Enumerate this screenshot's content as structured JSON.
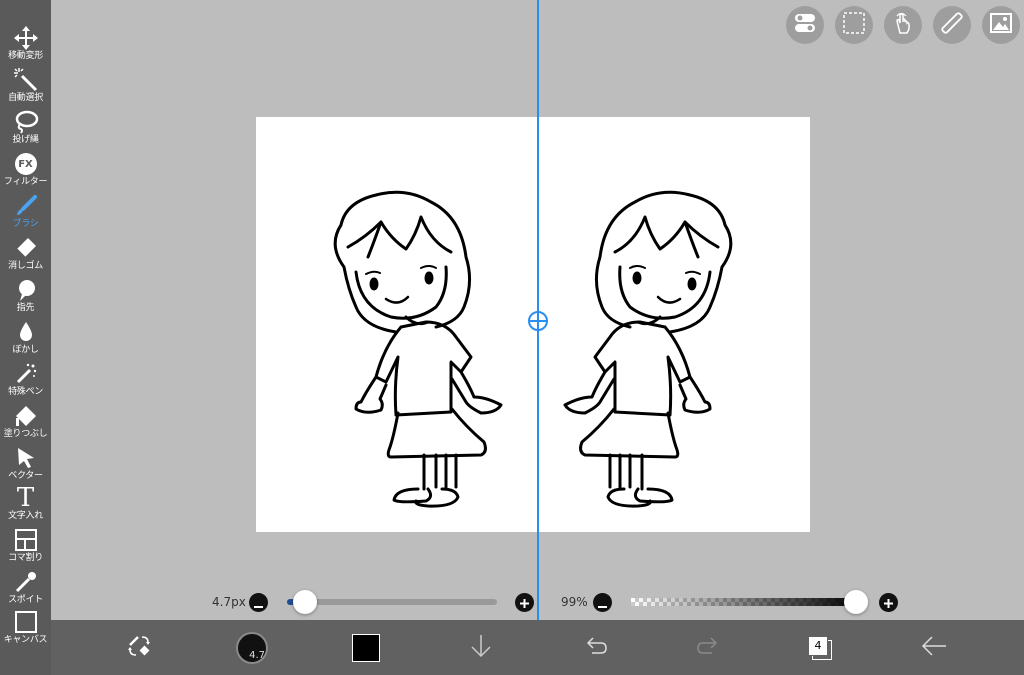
{
  "toolbar": {
    "items": [
      {
        "label": "移動変形",
        "icon": "move-icon"
      },
      {
        "label": "自動選択",
        "icon": "magic-wand-icon"
      },
      {
        "label": "投げ縄",
        "icon": "lasso-icon"
      },
      {
        "label": "フィルター",
        "icon": "fx-icon"
      },
      {
        "label": "ブラシ",
        "icon": "brush-icon"
      },
      {
        "label": "消しゴム",
        "icon": "eraser-icon"
      },
      {
        "label": "指先",
        "icon": "finger-icon"
      },
      {
        "label": "ぼかし",
        "icon": "blur-drop-icon"
      },
      {
        "label": "特殊ペン",
        "icon": "special-pen-icon"
      },
      {
        "label": "塗りつぶし",
        "icon": "bucket-icon"
      },
      {
        "label": "ベクター",
        "icon": "vector-arrow-icon"
      },
      {
        "label": "文字入れ",
        "icon": "text-icon"
      },
      {
        "label": "コマ割り",
        "icon": "panel-icon"
      },
      {
        "label": "スポイト",
        "icon": "eyedropper-icon"
      },
      {
        "label": "キャンバス",
        "icon": "canvas-icon"
      }
    ],
    "fx_glyph": "FX",
    "text_glyph": "T",
    "active_index": 4,
    "active_color": "#4aa3f0"
  },
  "top_buttons": [
    "toggle-icon",
    "selection-icon",
    "hand-gesture-icon",
    "ruler-icon",
    "image-icon"
  ],
  "brush_size": {
    "label": "4.7px",
    "value": 4.7,
    "slider_fraction": 0.08
  },
  "opacity": {
    "label": "99%",
    "value": 99
  },
  "bottom_bar": {
    "brush_preview_text": "4.7",
    "color": "#000000",
    "layer_count": "4"
  },
  "colors": {
    "symmetry_line": "#2a8ef0",
    "toolbar_bg": "#5a5a5a",
    "bottom_bg": "#616161"
  }
}
